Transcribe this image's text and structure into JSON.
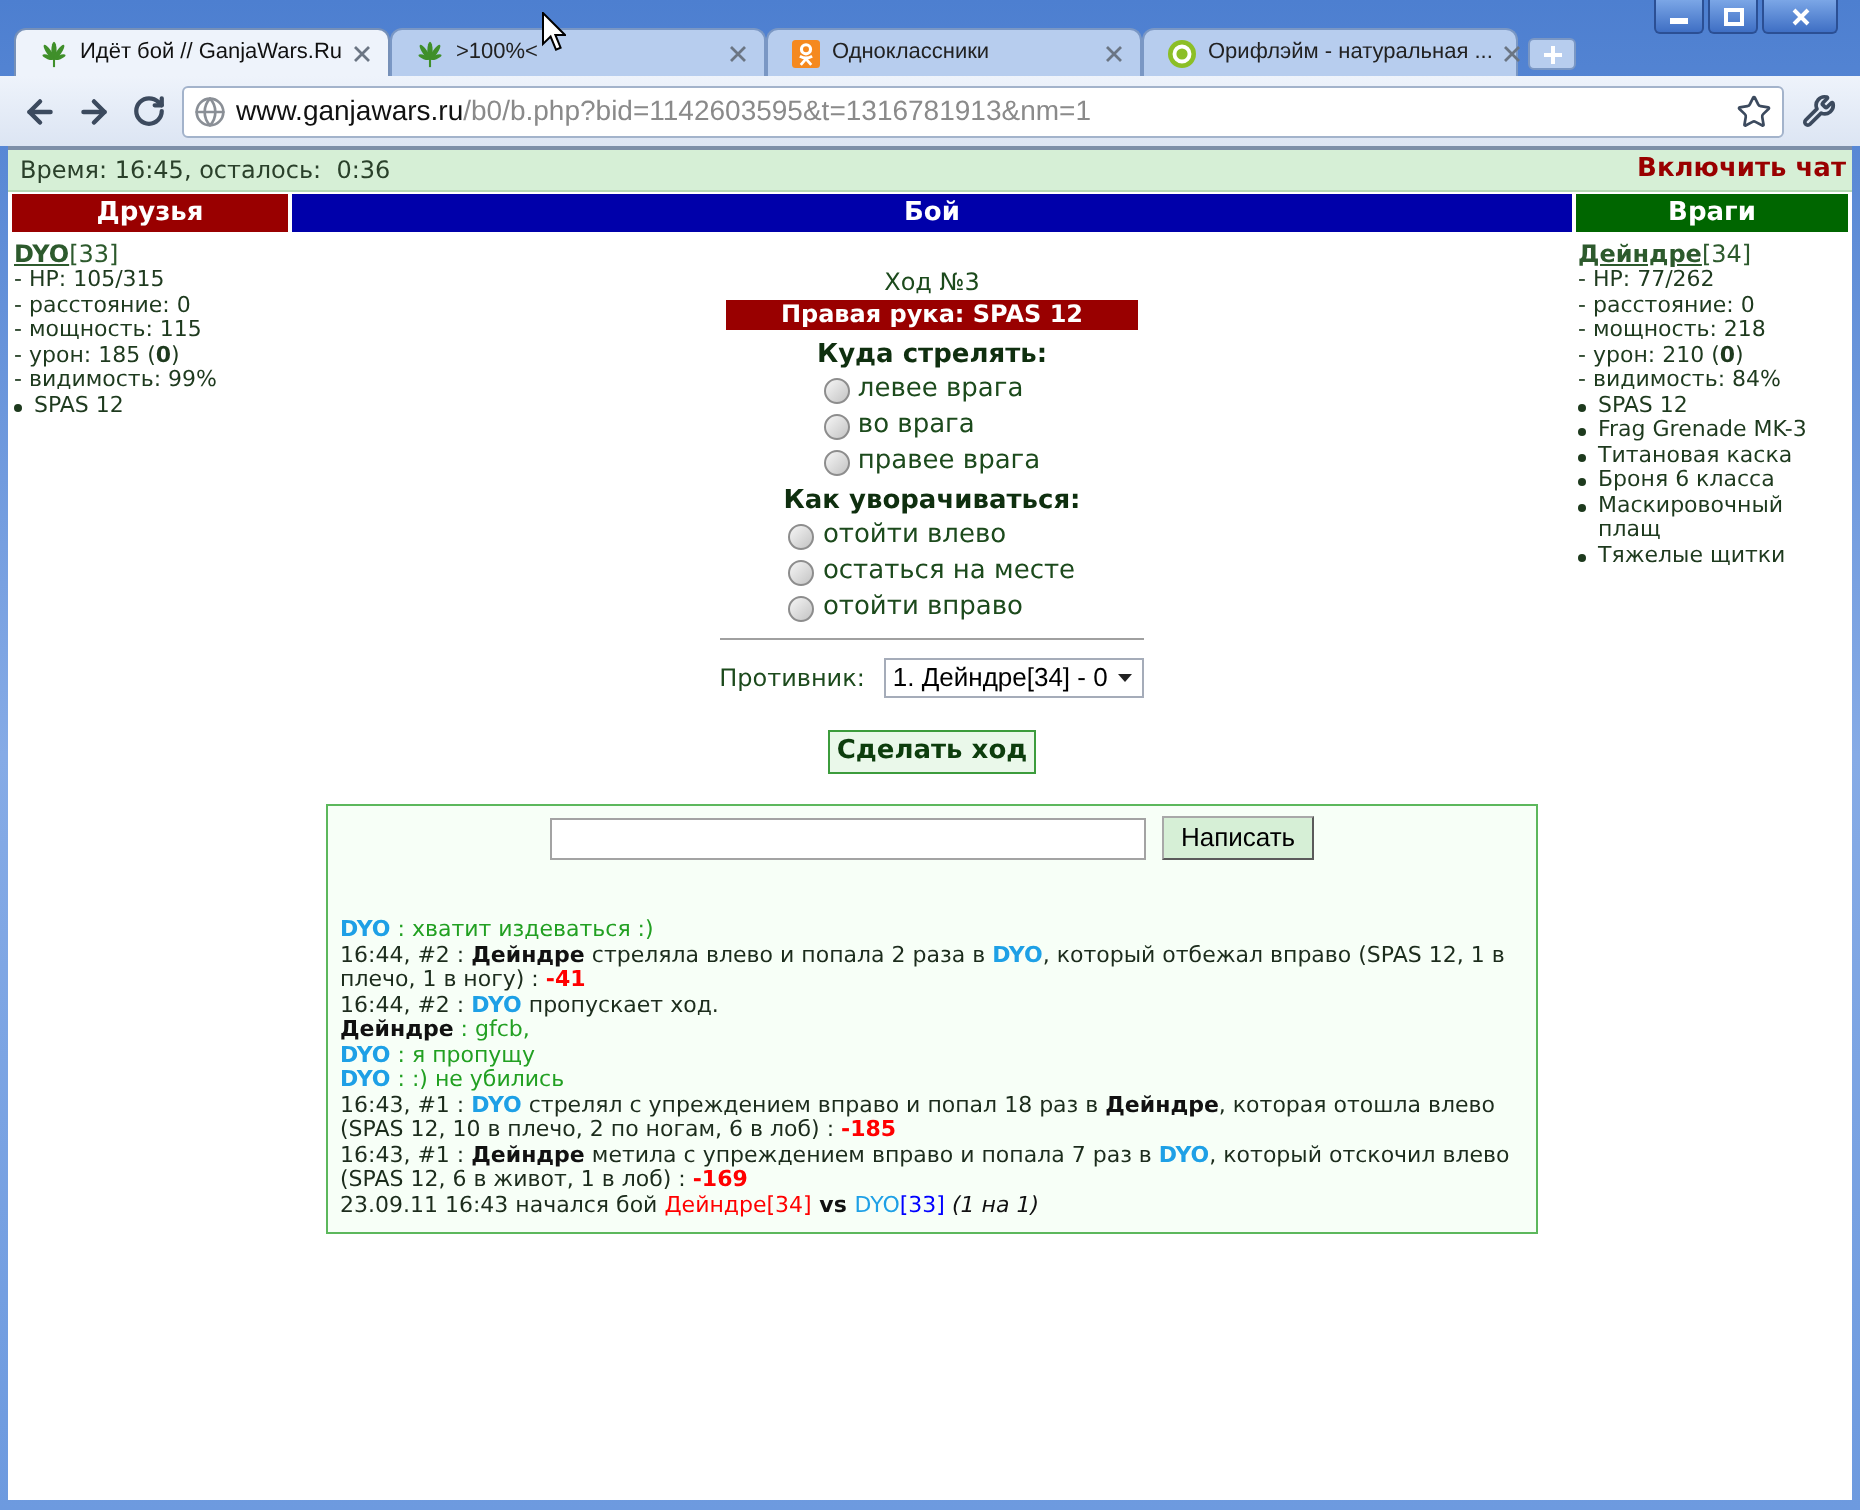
{
  "tabs": [
    {
      "kind": "leaf",
      "title": "Идёт бой // GanjaWars.Ru",
      "selected": true
    },
    {
      "kind": "leaf",
      "title": ">100%<",
      "selected": false
    },
    {
      "kind": "ok",
      "title": "Одноклассники",
      "selected": false
    },
    {
      "kind": "ring",
      "title": "Орифлэйм - натуральная ...",
      "selected": false
    }
  ],
  "address_bar": {
    "host": "www.ganjawars.ru",
    "path": "/b0/b.php?bid=1142603595&t=1316781913&nm=1"
  },
  "status_bar": {
    "time": "Время: 16:45, осталось:  0:36",
    "chat_link": "Включить чат"
  },
  "headers": [
    {
      "label": "Друзья",
      "color": "#990000"
    },
    {
      "label": "Бой",
      "color": "#0000aa"
    },
    {
      "label": "Враги",
      "color": "#006600"
    }
  ],
  "friends": [
    {
      "name": "DYO",
      "rank": "[33]",
      "stats": [
        "- HP: 105/315",
        "- расстояние: 0",
        "- мощность: 115",
        "- урон: 185 (**0**)",
        "- видимость: 99%"
      ],
      "items": [
        "SPAS 12"
      ]
    }
  ],
  "enemies": [
    {
      "name": "Дейндре",
      "rank": "[34]",
      "stats": [
        "- HP: 77/262",
        "- расстояние: 0",
        "- мощность: 218",
        "- урон: 210 (**0**)",
        "- видимость: 84%"
      ],
      "items": [
        "SPAS 12",
        "Frag Grenade MK-3",
        "Титановая каска",
        "Броня 6 класса",
        "Маскировочный плащ",
        "Тяжелые щитки"
      ]
    }
  ],
  "battle": {
    "turn": "Ход №3",
    "weapon": "Правая рука: SPAS 12",
    "groups": [
      {
        "heading": "Куда стрелять:",
        "options": [
          {
            "label": "левее врага",
            "selected": false
          },
          {
            "label": "во врага",
            "selected": false
          },
          {
            "label": "правее врага",
            "selected": false
          }
        ]
      },
      {
        "heading": "Как уворачиваться:",
        "options": [
          {
            "label": "отойти влево",
            "selected": false
          },
          {
            "label": "остаться на месте",
            "selected": false
          },
          {
            "label": "отойти вправо",
            "selected": false
          }
        ]
      }
    ],
    "opponent": {
      "label": "Противник:",
      "value": "1. Дейндре[34] - 0"
    },
    "submit": "Сделать ход"
  },
  "chat": {
    "send": "Написать",
    "log": [
      {
        "parts": [
          {
            "kind": "friend",
            "text": "DYO"
          },
          {
            "kind": "speech",
            "text": " : хватит издеваться :)"
          }
        ]
      },
      {
        "parts": [
          {
            "kind": "text",
            "text": "16:44, #2 : "
          },
          {
            "kind": "bold",
            "text": "Дейндре"
          },
          {
            "kind": "text",
            "text": " стреляла влево и попала 2 раза в "
          },
          {
            "kind": "friend",
            "text": "DYO"
          },
          {
            "kind": "text",
            "text": ", который отбежал вправо (SPAS 12, 1 в плечо, 1 в ногу) : "
          },
          {
            "kind": "damage",
            "text": "-41"
          }
        ]
      },
      {
        "parts": [
          {
            "kind": "text",
            "text": "16:44, #2 : "
          },
          {
            "kind": "friend",
            "text": "DYO"
          },
          {
            "kind": "text",
            "text": " пропускает ход."
          }
        ]
      },
      {
        "parts": [
          {
            "kind": "bold",
            "text": "Дейндре"
          },
          {
            "kind": "speech",
            "text": " : gfcb,"
          }
        ]
      },
      {
        "parts": [
          {
            "kind": "friend",
            "text": "DYO"
          },
          {
            "kind": "speech",
            "text": " : я пропущу"
          }
        ]
      },
      {
        "parts": [
          {
            "kind": "friend",
            "text": "DYO"
          },
          {
            "kind": "speech",
            "text": " : :) не убились"
          }
        ]
      },
      {
        "parts": [
          {
            "kind": "text",
            "text": "16:43, #1 : "
          },
          {
            "kind": "friend",
            "text": "DYO"
          },
          {
            "kind": "text",
            "text": " стрелял с упреждением вправо и попал 18 раз в "
          },
          {
            "kind": "bold",
            "text": "Дейндре"
          },
          {
            "kind": "text",
            "text": ", которая отошла влево (SPAS 12, 10 в плечо, 2 по ногам, 6 в лоб) : "
          },
          {
            "kind": "damage",
            "text": "-185"
          }
        ]
      },
      {
        "parts": [
          {
            "kind": "text",
            "text": "16:43, #1 : "
          },
          {
            "kind": "bold",
            "text": "Дейндре"
          },
          {
            "kind": "text",
            "text": " метила с упреждением вправо и попала 7 раз в "
          },
          {
            "kind": "friend",
            "text": "DYO"
          },
          {
            "kind": "text",
            "text": ", который отскочил влево (SPAS 12, 6 в живот, 1 в лоб) : "
          },
          {
            "kind": "damage",
            "text": "-169"
          }
        ]
      },
      {
        "parts": [
          {
            "kind": "text",
            "text": "23.09.11 16:43 начался бой "
          },
          {
            "kind": "red",
            "text": "Дейндре[34]"
          },
          {
            "kind": "bold",
            "text": " vs "
          },
          {
            "kind": "cyan",
            "text": "DYO"
          },
          {
            "kind": "blue",
            "text": "[33]"
          },
          {
            "kind": "italic",
            "text": " (1 на 1)"
          }
        ]
      }
    ]
  }
}
